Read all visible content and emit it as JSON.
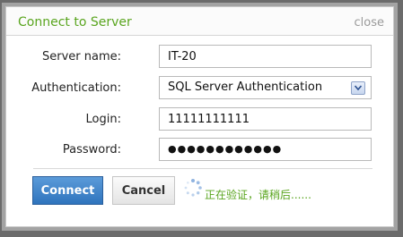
{
  "dialog": {
    "title": "Connect to Server",
    "close_label": "close"
  },
  "form": {
    "server_name": {
      "label": "Server name:",
      "value": "IT-20"
    },
    "authentication": {
      "label": "Authentication:",
      "value": "SQL Server Authentication"
    },
    "login": {
      "label": "Login:",
      "value": "11111111111"
    },
    "password": {
      "label": "Password:",
      "value": "●●●●●●●●●●●●"
    }
  },
  "buttons": {
    "connect": "Connect",
    "cancel": "Cancel"
  },
  "status": {
    "text": "正在验证，请稍后......"
  },
  "colors": {
    "title": "#5aa51f",
    "connect_button": "#3f85c9",
    "status_text": "#5aa51f"
  },
  "icons": {
    "spinner": "loading-spinner-icon",
    "dropdown": "chevron-down-icon"
  }
}
